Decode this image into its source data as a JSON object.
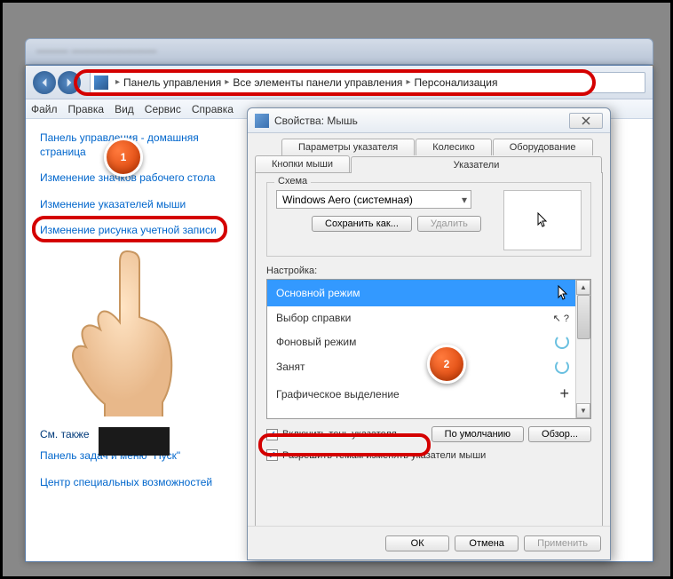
{
  "titlebar_blur": "———  ————————",
  "breadcrumb": {
    "items": [
      "Панель управления",
      "Все элементы панели управления",
      "Персонализация"
    ]
  },
  "menubar": [
    "Файл",
    "Правка",
    "Вид",
    "Сервис",
    "Справка"
  ],
  "sidebar": {
    "links": [
      "Панель управления - домашняя страница",
      "Изменение значков рабочего стола",
      "Изменение указателей мыши",
      "Изменение рисунка учетной записи"
    ],
    "see_also_title": "См. также",
    "see_also": [
      "Панель задач и меню \"Пуск\"",
      "Центр специальных возможностей"
    ]
  },
  "dialog": {
    "title": "Свойства: Мышь",
    "tabs_row1": [
      "Параметры указателя",
      "Колесико",
      "Оборудование"
    ],
    "tabs_row2": [
      "Кнопки мыши",
      "Указатели"
    ],
    "scheme_label": "Схема",
    "scheme_value": "Windows Aero (системная)",
    "save_as": "Сохранить как...",
    "delete": "Удалить",
    "list_label": "Настройка:",
    "list": [
      "Основной режим",
      "Выбор справки",
      "Фоновый режим",
      "Занят",
      "Графическое выделение"
    ],
    "shadow_label": "Включить тень указателя",
    "allow_themes_label": "Разрешить темам изменять указатели мыши",
    "defaults": "По умолчанию",
    "browse": "Обзор...",
    "ok": "ОК",
    "cancel": "Отмена",
    "apply": "Применить"
  },
  "badges": {
    "one": "1",
    "two": "2"
  }
}
